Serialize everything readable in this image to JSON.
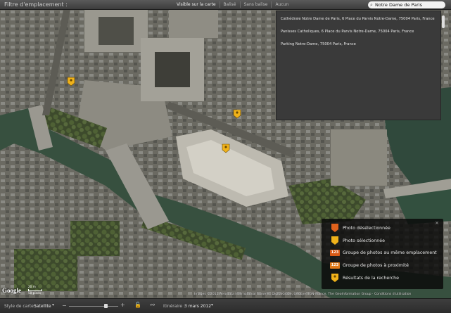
{
  "topbar": {
    "filter_label": "Filtre d'emplacement :",
    "options": [
      "Visible sur la carte",
      "Balisé",
      "Sans balise",
      "Aucun"
    ],
    "search_value": "Notre Dame de Paris"
  },
  "results": [
    "Cathédrale Notre Dame de Paris, 6 Place du Parvis Notre-Dame, 75004 Paris, France",
    "Panisses Catholiques, 6 Place du Parvis Notre-Dame, 75004 Paris, France",
    "Parking Notre-Dame, 75004 Paris, France"
  ],
  "legend": {
    "close": "×",
    "rows": [
      {
        "label": "Photo désélectionnée",
        "type": "pin",
        "color": "#e0621c"
      },
      {
        "label": "Photo sélectionnée",
        "type": "pin",
        "color": "#f0b21a"
      },
      {
        "label": "Groupe de photos au même emplacement",
        "type": "badge",
        "text": "123",
        "color": "#d85a16"
      },
      {
        "label": "Groupe de photos à proximité",
        "type": "badge",
        "text": "123",
        "color": "#e07a1a"
      },
      {
        "label": "Résultats de la recherche",
        "type": "search-pin",
        "color": "#f0b21a"
      }
    ]
  },
  "map": {
    "copyright": "Images ©2012 Aerodata International Surveys, DigitalGlobe, GeoEye, IGN-France, The GeoInformation Group · Conditions d'utilisation",
    "logo": "Google",
    "scale_top": "20 m",
    "scale_bottom": "50 pieds"
  },
  "bottombar": {
    "map_style_label": "Style de carte :",
    "map_style_value": "Satellite",
    "track_label": "Itinéraire :",
    "track_value": "3 mars 2012"
  }
}
